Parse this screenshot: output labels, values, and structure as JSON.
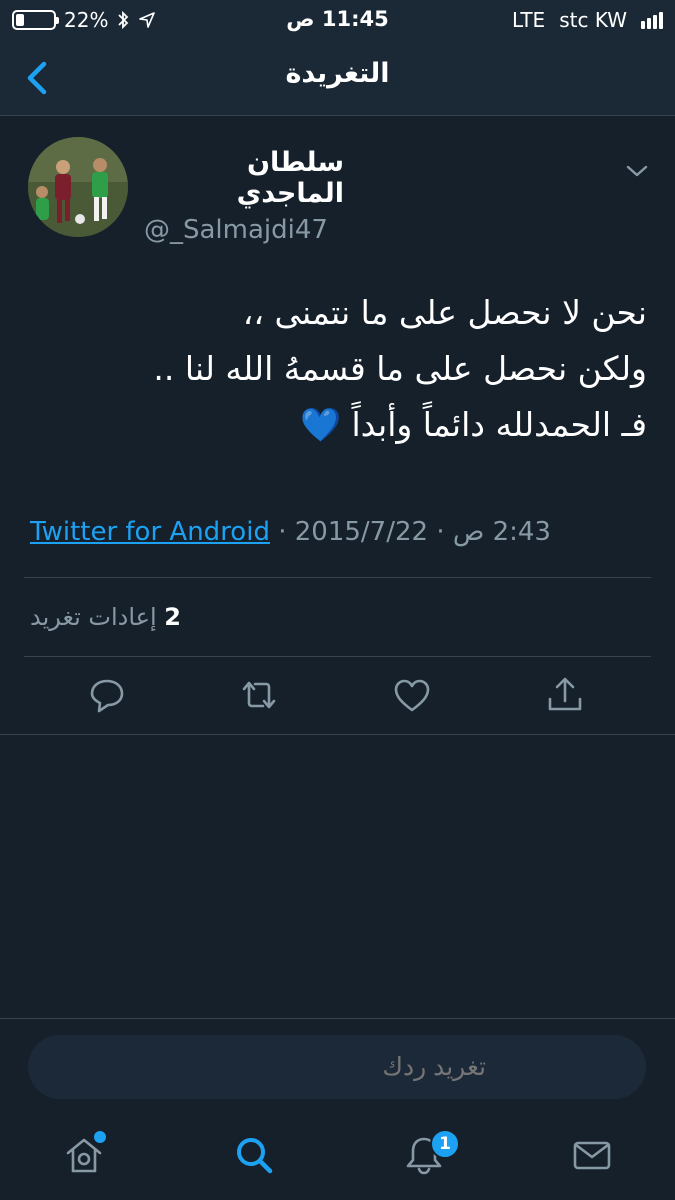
{
  "status_bar": {
    "battery": "22%",
    "battery_level": 0.22,
    "time": "11:45 ص",
    "network": "LTE",
    "carrier": "stc KW"
  },
  "header": {
    "title": "التغريدة"
  },
  "tweet": {
    "display_name": "سلطان الماجدي",
    "handle": "@_Salmajdi47",
    "lines": [
      "نحن لا نحصل على ما نتمنى ،،",
      "ولكن نحصل على ما قسمهُ الله لنا ..",
      "فـ الحمدلله دائماً وأبداً 💙"
    ],
    "time": "2:43 ص",
    "date": "2015/7/22",
    "source": "Twitter for Android",
    "retweet_count": "2",
    "retweet_label": "إعادات تغريد"
  },
  "reply": {
    "placeholder": "تغريد ردك"
  },
  "tabs": {
    "notifications_badge": "1"
  },
  "colors": {
    "background": "#15202b",
    "accent": "#1da1f2",
    "secondary_text": "#8899a6",
    "divider": "#38444d"
  }
}
